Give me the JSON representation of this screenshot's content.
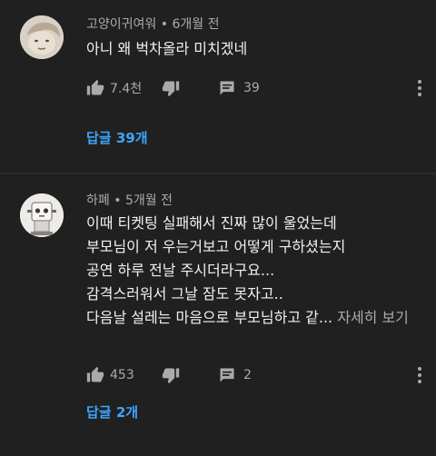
{
  "comments": [
    {
      "author": "고양이귀여워",
      "time": "6개월 전",
      "lines": [
        "아니 왜 벅차올라 미치겠네"
      ],
      "more": "",
      "likes": "7.4천",
      "reply_count": "39",
      "replies_label": "답글 39개"
    },
    {
      "author": "하폐",
      "time": "5개월 전",
      "lines": [
        "이때 티켓팅 실패해서 진짜 많이 울었는데",
        "부모님이 저 우는거보고 어떻게 구하셨는지",
        "공연 하루 전날 주시더라구요...",
        "감격스러워서 그날 잠도 못자고..",
        "다음날 설레는 마음으로 부모님하고 같..."
      ],
      "more": "자세히 보기",
      "likes": "453",
      "reply_count": "2",
      "replies_label": "답글 2개"
    }
  ],
  "separator": "•",
  "icons": {
    "like": "thumbs-up-icon",
    "dislike": "thumbs-down-icon",
    "reply": "comment-icon",
    "menu": "more-vert-icon"
  },
  "colors": {
    "background": "#202020",
    "text": "#f1f1f1",
    "secondary": "#aaaaaa",
    "link": "#3ea6ff"
  }
}
